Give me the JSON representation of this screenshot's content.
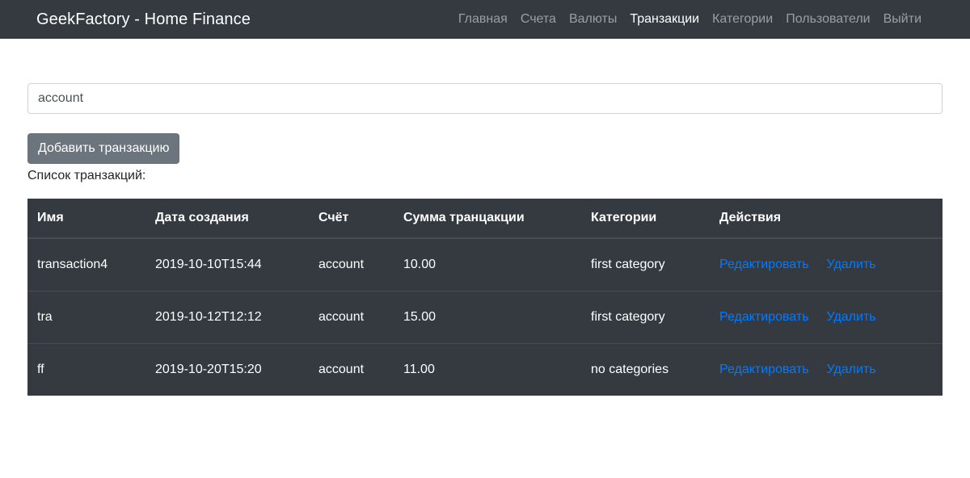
{
  "navbar": {
    "brand": "GeekFactory - Home Finance",
    "links": [
      {
        "label": "Главная",
        "active": false
      },
      {
        "label": "Счета",
        "active": false
      },
      {
        "label": "Валюты",
        "active": false
      },
      {
        "label": "Транзакции",
        "active": true
      },
      {
        "label": "Категории",
        "active": false
      },
      {
        "label": "Пользователи",
        "active": false
      },
      {
        "label": "Выйти",
        "active": false
      }
    ]
  },
  "search": {
    "value": "account"
  },
  "add_button_label": "Добавить транзакцию",
  "list_title": "Список транзакций:",
  "table": {
    "headers": [
      "Имя",
      "Дата создания",
      "Счёт",
      "Сумма транцакции",
      "Категории",
      "Действия"
    ],
    "rows": [
      {
        "name": "transaction4",
        "date": "2019-10-10T15:44",
        "account": "account",
        "amount": "10.00",
        "category": "first category"
      },
      {
        "name": "tra",
        "date": "2019-10-12T12:12",
        "account": "account",
        "amount": "15.00",
        "category": "first category"
      },
      {
        "name": "ff",
        "date": "2019-10-20T15:20",
        "account": "account",
        "amount": "11.00",
        "category": "no categories"
      }
    ],
    "edit_label": "Редактировать",
    "delete_label": "Удалить"
  },
  "colors": {
    "navbar_bg": "#343a40",
    "table_bg": "#343a40",
    "link_blue": "#007bff",
    "button_gray": "#6c757d"
  }
}
